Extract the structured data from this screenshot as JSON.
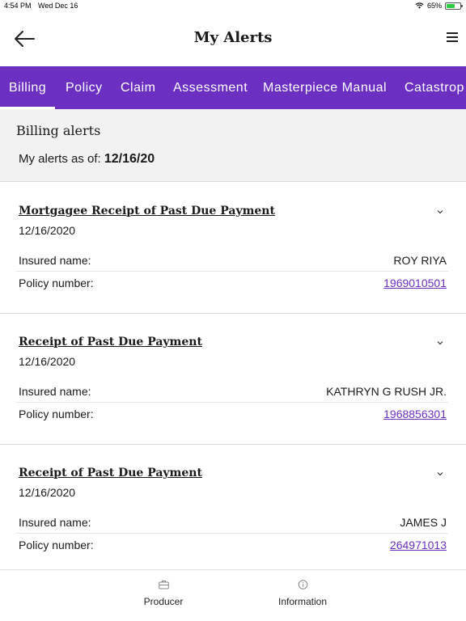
{
  "status": {
    "time": "4:54 PM",
    "date": "Wed Dec 16",
    "battery": "65%",
    "battery_level": 0.65
  },
  "header": {
    "title": "My Alerts"
  },
  "tabs": [
    {
      "label": "Billing",
      "active": true
    },
    {
      "label": "Policy"
    },
    {
      "label": "Claim"
    },
    {
      "label": "Assessment"
    },
    {
      "label": "Masterpiece Manual"
    },
    {
      "label": "Catastrop"
    }
  ],
  "section": {
    "heading": "Billing alerts",
    "asof_label": "My alerts as of:",
    "asof_date": "12/16/20"
  },
  "labels": {
    "insured": "Insured name:",
    "policy": "Policy number:"
  },
  "alerts": [
    {
      "title": "Mortgagee Receipt of Past Due Payment",
      "date": "12/16/2020",
      "insured": "ROY RIYA",
      "policy": "1969010501"
    },
    {
      "title": "Receipt of Past Due Payment",
      "date": "12/16/2020",
      "insured": "KATHRYN G RUSH JR.",
      "policy": "1968856301"
    },
    {
      "title": "Receipt of Past Due Payment",
      "date": "12/16/2020",
      "insured": "JAMES J",
      "policy": "264971013"
    }
  ],
  "bottomnav": [
    {
      "label": "Producer",
      "icon": "briefcase-icon"
    },
    {
      "label": "Information",
      "icon": "info-icon"
    }
  ],
  "colors": {
    "accent": "#6b2fc2",
    "link": "#6b2fc2",
    "section_bg": "#f2f2f2"
  }
}
